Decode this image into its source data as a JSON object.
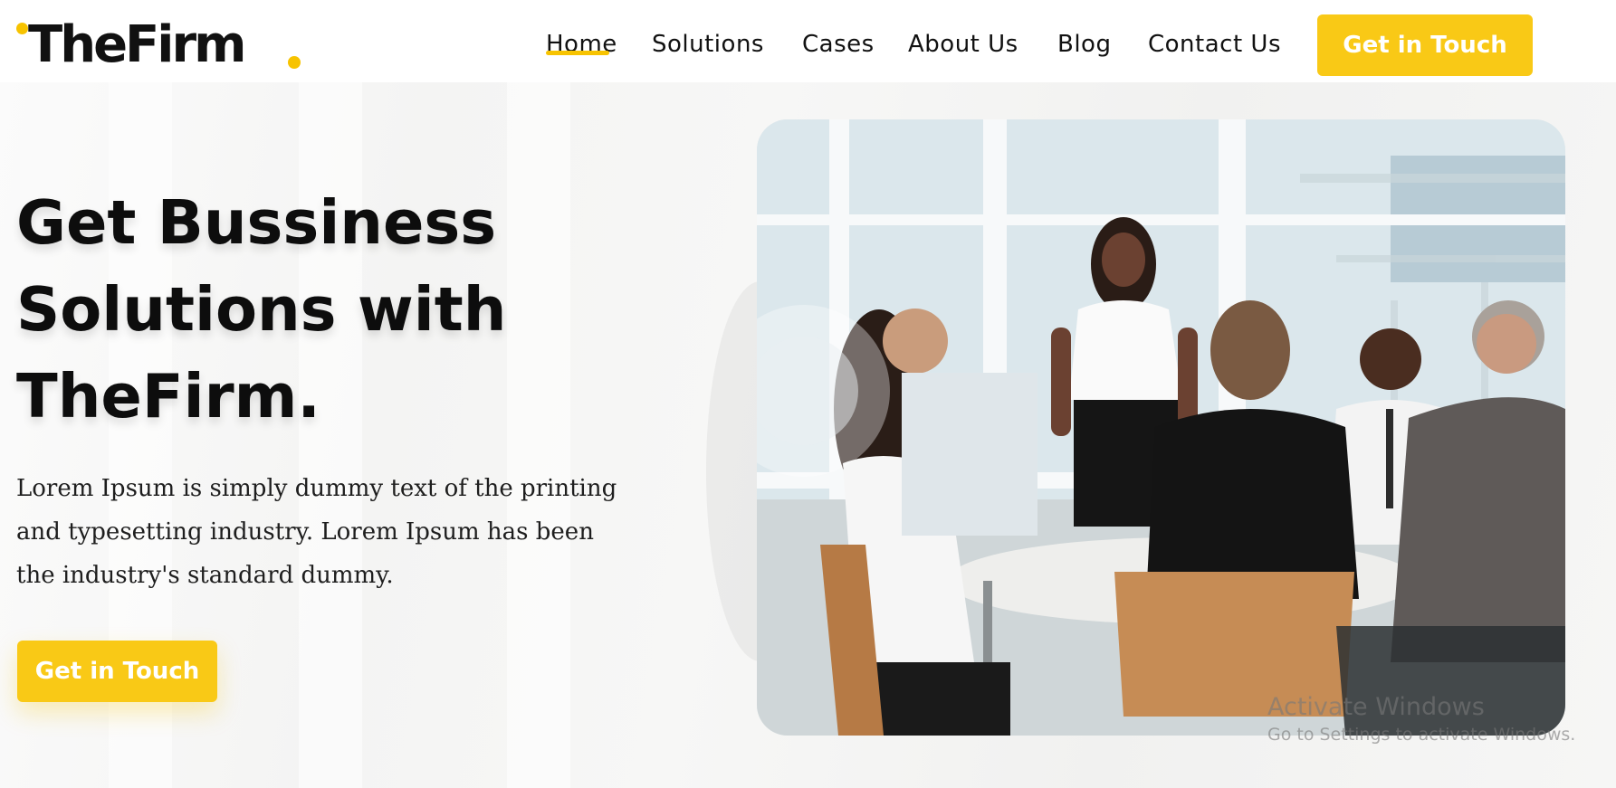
{
  "header": {
    "logo_text": "TheFirm",
    "nav": [
      {
        "label": "Home",
        "active": true
      },
      {
        "label": "Solutions"
      },
      {
        "label": "Cases"
      },
      {
        "label": "About Us"
      },
      {
        "label": "Blog"
      },
      {
        "label": "Contact Us"
      }
    ],
    "cta_label": "Get in Touch"
  },
  "hero": {
    "title_lines": [
      "Get Bussiness",
      "Solutions with",
      "TheFirm."
    ],
    "description_lines": [
      "Lorem Ipsum is simply dummy text of the printing",
      "and typesetting industry. Lorem Ipsum has been",
      "the industry's standard dummy."
    ],
    "cta_label": "Get in Touch",
    "image": "business-meeting-photo"
  },
  "watermark": {
    "title": "Activate Windows",
    "subtitle": "Go to Settings to activate Windows."
  },
  "colors": {
    "accent": "#f9c916",
    "text": "#111111",
    "background": "#ffffff"
  }
}
